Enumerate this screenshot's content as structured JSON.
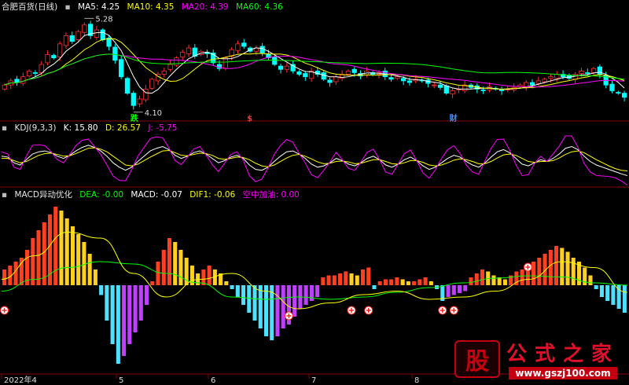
{
  "panels": {
    "main": {
      "title": "合肥百货(日线)",
      "ma": [
        {
          "label": "MA5: 4.25",
          "color": "#ffffff"
        },
        {
          "label": "MA10: 4.35",
          "color": "#ffff00"
        },
        {
          "label": "MA20: 4.39",
          "color": "#ff00ff"
        },
        {
          "label": "MA60: 4.36",
          "color": "#00ff00"
        }
      ],
      "high_label": "5.28",
      "low_label": "4.10",
      "markers": [
        {
          "text": "跌",
          "color": "#00ff00"
        },
        {
          "text": "$",
          "color": "#ff3030"
        },
        {
          "text": "财",
          "color": "#3a8fff"
        }
      ]
    },
    "kdj": {
      "title": "KDJ(9,3,3)",
      "values": [
        {
          "label": "K: 15.80",
          "color": "#ffffff"
        },
        {
          "label": "D: 26.57",
          "color": "#ffff00"
        },
        {
          "label": "J: -5.75",
          "color": "#ff00ff"
        }
      ]
    },
    "macd": {
      "title": "MACD异动优化",
      "values": [
        {
          "label": "DEA: -0.00",
          "color": "#00ff00"
        },
        {
          "label": "MACD: -0.07",
          "color": "#ffffff"
        },
        {
          "label": "DIF1: -0.06",
          "color": "#ffff00"
        },
        {
          "label": "空中加油: 0.00",
          "color": "#ff00ff"
        }
      ]
    }
  },
  "x_axis": [
    "2022年4",
    "5",
    "6",
    "7",
    "8"
  ],
  "watermark": {
    "title": "公式之家",
    "url": "www.gszj100.com",
    "logo_text": "股"
  },
  "colors": {
    "up": "#ff3030",
    "down": "#00ffff",
    "ma5": "#ffffff",
    "ma10": "#ffff00",
    "ma20": "#ff00ff",
    "ma60": "#00ff00"
  },
  "chart_data": [
    {
      "type": "candlestick",
      "ma": {
        "MA5": 4.25,
        "MA10": 4.35,
        "MA20": 4.39,
        "MA60": 4.36
      },
      "high": 5.28,
      "low": 4.1,
      "ylim": [
        4.05,
        5.35
      ],
      "close": [
        4.45,
        4.5,
        4.48,
        4.55,
        4.62,
        4.6,
        4.7,
        4.82,
        4.78,
        4.95,
        5.05,
        4.98,
        5.1,
        5.18,
        5.05,
        5.12,
        5.0,
        4.92,
        4.75,
        4.55,
        4.35,
        4.2,
        4.28,
        4.4,
        4.52,
        4.58,
        4.62,
        4.7,
        4.78,
        4.85,
        4.9,
        4.8,
        4.86,
        4.83,
        4.72,
        4.65,
        4.78,
        4.88,
        4.95,
        4.92,
        4.86,
        4.9,
        4.84,
        4.78,
        4.7,
        4.64,
        4.68,
        4.62,
        4.58,
        4.55,
        4.62,
        4.58,
        4.52,
        4.48,
        4.55,
        4.58,
        4.62,
        4.6,
        4.56,
        4.62,
        4.58,
        4.6,
        4.55,
        4.52,
        4.55,
        4.5,
        4.48,
        4.52,
        4.5,
        4.47,
        4.45,
        4.42,
        4.35,
        4.38,
        4.4,
        4.45,
        4.42,
        4.4,
        4.38,
        4.43,
        4.4,
        4.38,
        4.4,
        4.42,
        4.45,
        4.48,
        4.45,
        4.5,
        4.52,
        4.55,
        4.58,
        4.55,
        4.53,
        4.58,
        4.62,
        4.6,
        4.65,
        4.58,
        4.45,
        4.38,
        4.35,
        4.3
      ]
    },
    {
      "type": "line",
      "series": [
        {
          "name": "K",
          "values": [
            60,
            58,
            45,
            40,
            52,
            65,
            70,
            72,
            68,
            60,
            55,
            62,
            72,
            80,
            85,
            80,
            72,
            60,
            45,
            35,
            28,
            35,
            48,
            60,
            72,
            78,
            82,
            75,
            62,
            55,
            60,
            68,
            72,
            65,
            55,
            45,
            50,
            58,
            62,
            55,
            40,
            30,
            28,
            35,
            48,
            60,
            70,
            72,
            65,
            55,
            42,
            35,
            38,
            45,
            55,
            50,
            42,
            38,
            45,
            55,
            60,
            52,
            40,
            35,
            42,
            52,
            58,
            50,
            38,
            30,
            35,
            45,
            55,
            62,
            58,
            48,
            40,
            35,
            45,
            58,
            70,
            75,
            68,
            55,
            42,
            38,
            45,
            52,
            48,
            55,
            65,
            78,
            82,
            75,
            60,
            48,
            40,
            35,
            30,
            25,
            20,
            15.8
          ]
        },
        {
          "name": "D",
          "values": [
            55,
            55,
            50,
            45,
            48,
            55,
            62,
            66,
            67,
            64,
            60,
            61,
            66,
            72,
            78,
            79,
            76,
            70,
            60,
            50,
            40,
            38,
            42,
            50,
            58,
            65,
            72,
            73,
            68,
            62,
            61,
            64,
            67,
            66,
            62,
            55,
            53,
            55,
            58,
            57,
            52,
            44,
            38,
            36,
            40,
            48,
            56,
            62,
            64,
            60,
            54,
            47,
            43,
            44,
            48,
            49,
            47,
            43,
            44,
            48,
            52,
            52,
            48,
            43,
            42,
            45,
            50,
            50,
            46,
            40,
            38,
            40,
            45,
            51,
            54,
            52,
            48,
            43,
            43,
            48,
            56,
            63,
            65,
            62,
            55,
            48,
            46,
            48,
            48,
            50,
            56,
            64,
            70,
            72,
            68,
            60,
            52,
            45,
            38,
            32,
            28,
            26.57
          ]
        },
        {
          "name": "J",
          "values": [
            70,
            65,
            35,
            30,
            60,
            85,
            86,
            84,
            70,
            52,
            45,
            64,
            84,
            96,
            99,
            82,
            64,
            40,
            15,
            5,
            4,
            29,
            60,
            80,
            100,
            104,
            102,
            79,
            50,
            41,
            58,
            76,
            82,
            63,
            41,
            25,
            44,
            64,
            70,
            51,
            16,
            2,
            8,
            33,
            64,
            84,
            98,
            92,
            67,
            45,
            18,
            11,
            28,
            47,
            69,
            52,
            32,
            28,
            47,
            69,
            76,
            52,
            24,
            19,
            42,
            66,
            74,
            50,
            22,
            10,
            29,
            55,
            75,
            84,
            66,
            40,
            24,
            19,
            49,
            78,
            98,
            99,
            74,
            41,
            16,
            18,
            43,
            60,
            48,
            65,
            83,
            106,
            106,
            81,
            44,
            24,
            16,
            15,
            14,
            11,
            4,
            -5.75
          ]
        }
      ]
    },
    {
      "type": "bar",
      "values": [
        0.08,
        0.1,
        0.12,
        0.14,
        0.18,
        0.24,
        0.28,
        0.32,
        0.36,
        0.4,
        0.38,
        0.34,
        0.3,
        0.26,
        0.22,
        0.16,
        0.08,
        -0.05,
        -0.18,
        -0.3,
        -0.4,
        -0.36,
        -0.3,
        -0.24,
        -0.18,
        -0.1,
        0.02,
        0.12,
        0.18,
        0.24,
        0.22,
        0.18,
        0.14,
        0.1,
        0.06,
        0.08,
        0.1,
        0.08,
        0.06,
        0.02,
        -0.02,
        -0.06,
        -0.1,
        -0.14,
        -0.18,
        -0.22,
        -0.26,
        -0.28,
        -0.26,
        -0.22,
        -0.2,
        -0.16,
        -0.12,
        -0.1,
        -0.08,
        -0.06,
        0.04,
        0.05,
        0.05,
        0.06,
        0.07,
        0.06,
        0.05,
        0.08,
        0.09,
        -0.02,
        0.02,
        0.03,
        0.03,
        0.04,
        0.03,
        0.02,
        0.02,
        0.03,
        0.04,
        0.02,
        -0.02,
        -0.08,
        -0.06,
        -0.05,
        -0.04,
        -0.03,
        0.04,
        0.06,
        0.08,
        0.07,
        0.05,
        0.04,
        0.03,
        0.05,
        0.07,
        0.08,
        0.1,
        0.12,
        0.14,
        0.16,
        0.18,
        0.2,
        0.19,
        0.17,
        0.14,
        0.12,
        0.09,
        0.05,
        -0.02,
        -0.06,
        -0.08,
        -0.1,
        -0.12,
        -0.14
      ],
      "series": [
        {
          "name": "DEA",
          "values": [
            -0.05,
            0.05,
            0.15,
            0.2,
            0.18,
            0.1,
            0.02,
            -0.1,
            -0.12,
            -0.1,
            -0.12,
            -0.1,
            -0.06,
            -0.02,
            0.02,
            0.06,
            0.08,
            0.07,
            0.02,
            0.0
          ]
        },
        {
          "name": "DIF1",
          "values": [
            0.05,
            0.25,
            0.45,
            0.4,
            0.1,
            -0.1,
            0.05,
            0.1,
            -0.05,
            -0.2,
            -0.15,
            -0.08,
            -0.05,
            -0.12,
            -0.1,
            -0.05,
            0.05,
            0.2,
            0.15,
            -0.06
          ]
        }
      ],
      "markers": 7
    }
  ]
}
